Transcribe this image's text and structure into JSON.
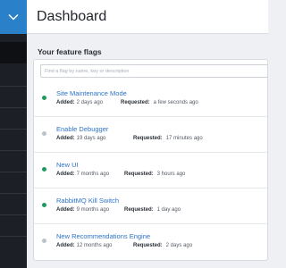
{
  "header": {
    "title": "Dashboard"
  },
  "section": {
    "title": "Your feature flags"
  },
  "search": {
    "placeholder": "Find a flag by name, key or description"
  },
  "colors": {
    "enabled": "#1e9b5e",
    "disabled": "#bcc2ca",
    "accent": "#2a80c9"
  },
  "labels": {
    "added": "Added:",
    "requested": "Requested:"
  },
  "flags": [
    {
      "name": "Site Maintenance Mode",
      "added": "2 days ago",
      "requested": "a few seconds ago",
      "status": "enabled"
    },
    {
      "name": "Enable Debugger",
      "added": "19 days ago",
      "requested": "17 minutes ago",
      "status": "disabled"
    },
    {
      "name": "New UI",
      "added": "7 months ago",
      "requested": "3 hours ago",
      "status": "enabled"
    },
    {
      "name": "RabbitMQ Kill Switch",
      "added": "9 months ago",
      "requested": "1 day ago",
      "status": "enabled"
    },
    {
      "name": "New Recommendations Engine",
      "added": "12 months ago",
      "requested": "2 days ago",
      "status": "disabled"
    }
  ]
}
